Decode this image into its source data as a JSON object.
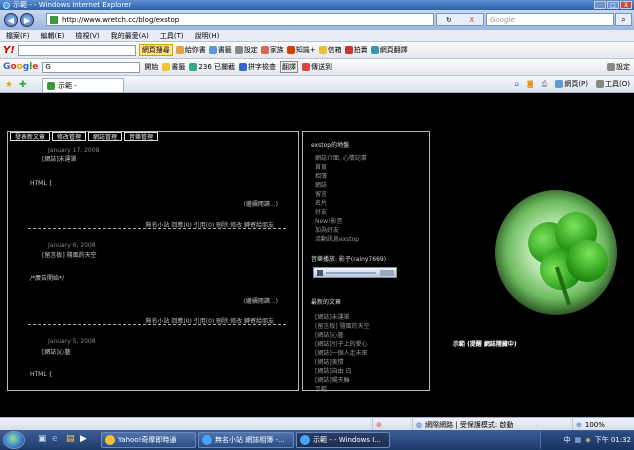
{
  "window": {
    "title": "示範 - - Windows Internet Explorer",
    "minimize": "_",
    "maximize": "□",
    "close": "X"
  },
  "address": {
    "back": "◀",
    "forward": "▶",
    "url": "http://www.wretch.cc/blog/exstop",
    "refresh": "↻",
    "stop": "X",
    "search_placeholder": "Google",
    "search_go": "⌕"
  },
  "menu": [
    "檔案(F)",
    "編輯(E)",
    "檢視(V)",
    "我的最愛(A)",
    "工具(T)",
    "說明(H)"
  ],
  "yahoo_toolbar": {
    "logo": "Y!",
    "search_btn": "網頁搜尋",
    "items": [
      "給你書",
      "書籤",
      "設定",
      "家族",
      "知識+",
      "信箱",
      "拍賣",
      "網頁翻譯"
    ]
  },
  "google_toolbar": {
    "logo": "Google",
    "input_prefix": "G",
    "go_label": "開始",
    "bookmarks": "書籤",
    "blocked": "236 已攔截",
    "spell": "拼字檢查",
    "translate": "翻譯",
    "send": "傳送到",
    "settings": "設定"
  },
  "tabs": {
    "current": "示範 -",
    "page_menu": "網頁(P)",
    "tools_menu": "工具(O)"
  },
  "blog": {
    "panel_tabs": [
      "發表新文章",
      "修改管理",
      "網誌管理",
      "音樂管理"
    ],
    "posts": [
      {
        "date": "January 17, 2008",
        "title": "[網誌]未運單",
        "body": "HTML {",
        "more": "(繼續閱讀...)",
        "footer": "無名小站 回應(0) 引用(0) 刪除 修改 轉寄給朋友"
      },
      {
        "date": "January 6, 2008",
        "title": "[留言板] 隨風的天空",
        "body": "/*廣告開始*/",
        "more": "(繼續閱讀...)",
        "footer": "無名小站 回應(0) 引用(0) 刪除 修改 轉寄給朋友"
      },
      {
        "date": "January 5, 2008",
        "title": "[網誌]心藝",
        "body": "HTML {",
        "more": "",
        "footer": ""
      }
    ]
  },
  "sidebar": {
    "site_title": "exstop的地盤",
    "links": [
      "網誌介面, 心情記事",
      "首頁",
      "相簿",
      "網誌",
      "留言",
      "名片",
      "好友",
      "New!影音",
      "加為好友",
      "活動訊息exstop"
    ],
    "music_title": "音樂播放: 影子(rainy7669)",
    "recent_title": "最新的文章",
    "recent": [
      "[網誌]未運單",
      "[留言板] 隨風的天空",
      "[網誌]心藝",
      "[網誌]引子上的愛心",
      "[網誌]一個人走未來",
      "[網誌]美情",
      "[網誌]自由 白",
      "[網誌]陽天輪",
      "示範"
    ]
  },
  "clover_label": "示範 (提醒 網誌隱藏中)",
  "status": {
    "zone": "網際網路 | 受保護模式: 啟動",
    "zoom": "100%"
  },
  "taskbar": {
    "buttons": [
      "Yahoo!奇摩即時通",
      "無名小站 網誌相簿 -...",
      "示範 - - Windows I..."
    ],
    "tray_lang": "中",
    "time": "下午 01:32"
  },
  "colors": {
    "accent": "#2f5fa6",
    "clover": "#2a9a18"
  }
}
